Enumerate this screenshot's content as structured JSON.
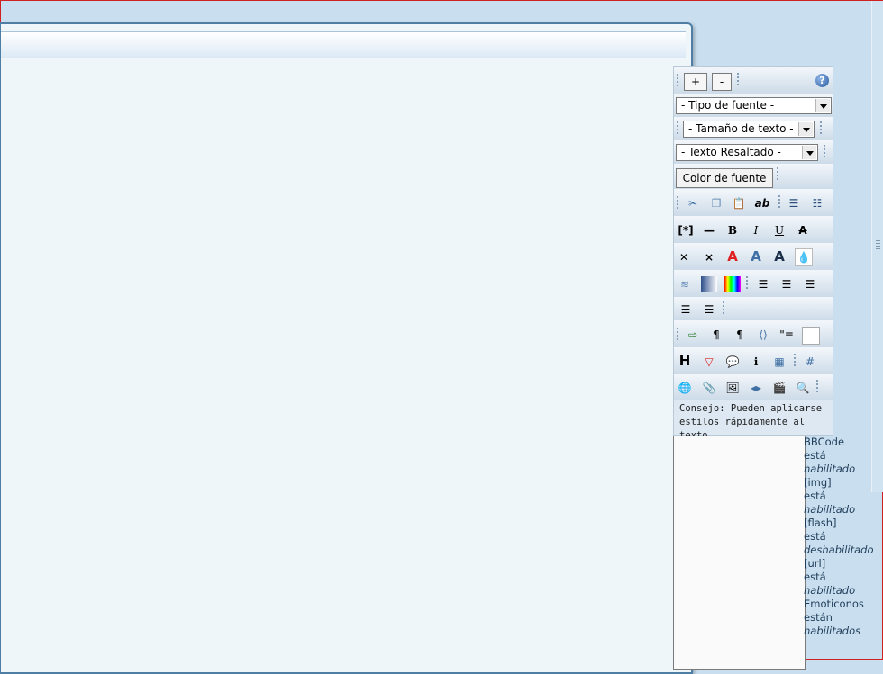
{
  "toolbar": {
    "plus_label": "+",
    "minus_label": "-",
    "help_label": "?",
    "font_type": "- Tipo de fuente -",
    "text_size": "- Tamaño de texto -",
    "highlight": "- Texto Resaltado -",
    "font_color_button": "Color de fuente",
    "tip": "Consejo: Pueden aplicarse estilos rápidamente al texto"
  },
  "status": {
    "bbcode": "BBCode",
    "bbcode_state_1": "está",
    "bbcode_state_2": "habilitado",
    "img": "[img]",
    "img_state_1": "está",
    "img_state_2": "habilitado",
    "flash": "[flash]",
    "flash_state_1": "está",
    "flash_state_2": "deshabilitado",
    "url": "[url]",
    "url_state_1": "está",
    "url_state_2": "habilitado",
    "emoticons": "Emoticonos",
    "emoticons_state_1": "están",
    "emoticons_state_2": "habilitados"
  },
  "icons": {
    "strike": "A",
    "font_a": "A",
    "heading": "H",
    "bold": "B",
    "italic": "I",
    "underline": "U",
    "list_bullets": "☰",
    "ab": "ab",
    "hr": "—"
  },
  "colors": {
    "background": "#c9dff0",
    "accent_border": "#4f7ea4",
    "outer_border": "#d02020"
  }
}
